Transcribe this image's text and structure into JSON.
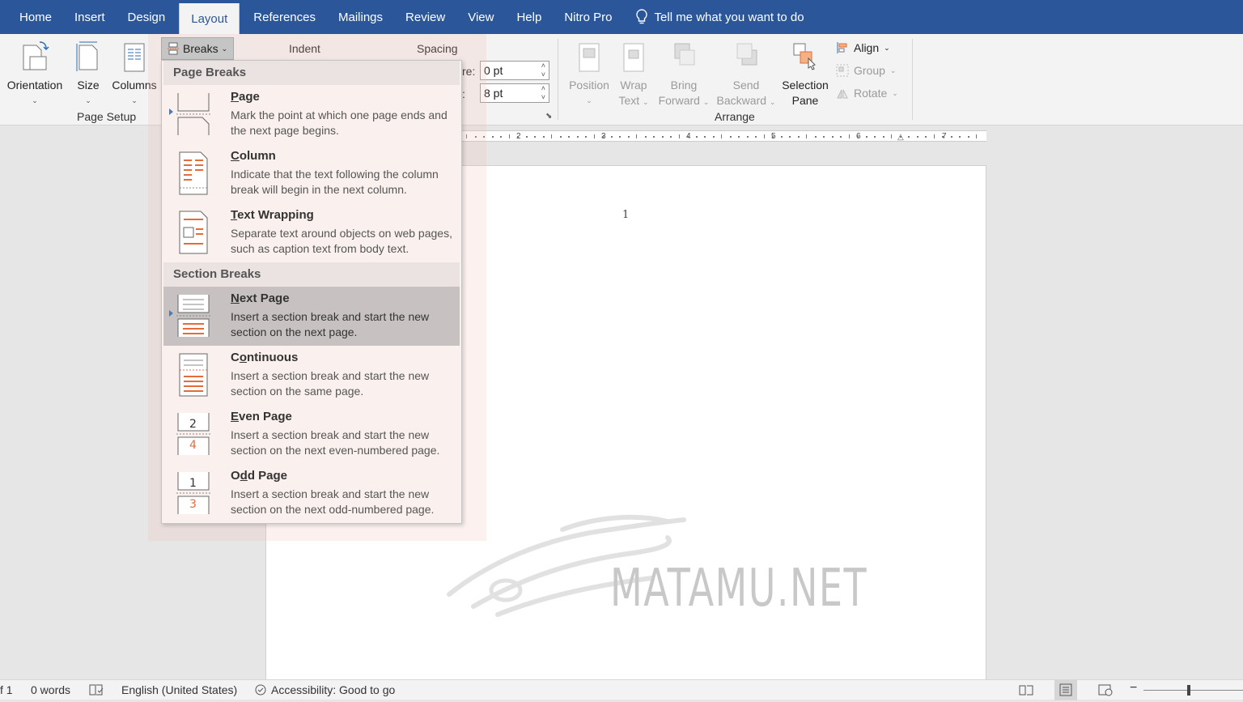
{
  "tabs": [
    "Home",
    "Insert",
    "Design",
    "Layout",
    "References",
    "Mailings",
    "Review",
    "View",
    "Help",
    "Nitro Pro"
  ],
  "active_tab": "Layout",
  "tell_me": "Tell me what you want to do",
  "page_setup": {
    "orientation": "Orientation",
    "size": "Size",
    "columns": "Columns",
    "label": "Page Setup"
  },
  "breaks_label": "Breaks",
  "paragraph": {
    "indent": "Indent",
    "spacing": "Spacing",
    "before_label": "re:",
    "before_value": "0 pt",
    "after_label": ":",
    "after_value": "8 pt"
  },
  "arrange": {
    "position": [
      "Position"
    ],
    "wrap": [
      "Wrap",
      "Text"
    ],
    "bring": [
      "Bring",
      "Forward"
    ],
    "send": [
      "Send",
      "Backward"
    ],
    "selection": [
      "Selection",
      "Pane"
    ],
    "align": "Align",
    "group": "Group",
    "rotate": "Rotate",
    "label": "Arrange"
  },
  "ruler_numbers": [
    "2",
    "3",
    "4",
    "5",
    "6",
    "7"
  ],
  "menu": {
    "page_breaks_header": "Page Breaks",
    "section_breaks_header": "Section Breaks",
    "page_breaks": [
      {
        "mn": "P",
        "rest": "age",
        "desc": "Mark the point at which one page ends and the next page begins."
      },
      {
        "mn": "C",
        "rest": "olumn",
        "desc": "Indicate that the text following the column break will begin in the next column."
      },
      {
        "mn": "T",
        "rest": "ext Wrapping",
        "desc": "Separate text around objects on web pages, such as caption text from body text."
      }
    ],
    "section_breaks": [
      {
        "mn": "N",
        "rest": "ext Page",
        "desc": "Insert a section break and start the new section on the next page."
      },
      {
        "pre": "C",
        "mn": "o",
        "rest": "ntinuous",
        "desc": "Insert a section break and start the new section on the same page."
      },
      {
        "mn": "E",
        "rest": "ven Page",
        "desc": "Insert a section break and start the new section on the next even-numbered page."
      },
      {
        "pre": "O",
        "mn": "d",
        "rest": "d Page",
        "desc": "Insert a section break and start the new section on the next odd-numbered page."
      }
    ]
  },
  "document": {
    "page_number": "1",
    "watermark": "MATAMU.NET"
  },
  "status": {
    "page": "f 1",
    "words": "0 words",
    "language": "English (United States)",
    "accessibility": "Accessibility: Good to go"
  },
  "colors": {
    "title_bar": "#2b579a",
    "ribbon": "#f3f3f3",
    "icon_accent": "#e46c3b"
  }
}
